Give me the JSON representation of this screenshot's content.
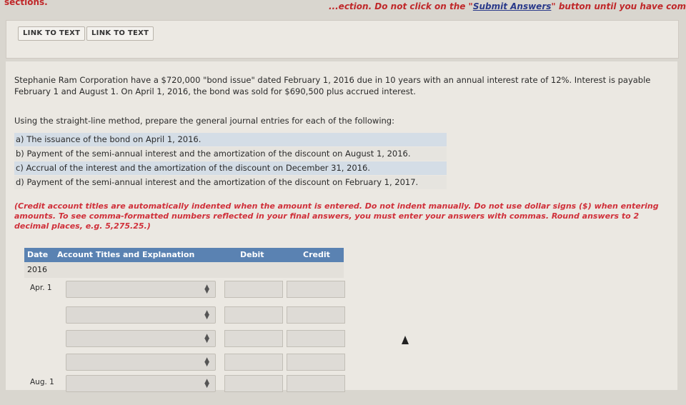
{
  "top": {
    "left_fragment": "sections.",
    "right_prefix": "...ection. Do not click on the \"",
    "right_link": "Submit Answers",
    "right_suffix": "\" button until you have completed all of the"
  },
  "links": [
    "LINK TO TEXT",
    "LINK TO TEXT"
  ],
  "problem_text": "Stephanie Ram Corporation have a $720,000 \"bond issue\" dated February 1, 2016 due in 10 years with an annual interest rate of 12%. Interest is payable February 1 and August 1. On April 1, 2016, the bond was sold for $690,500 plus accrued interest.",
  "instruction": "Using the straight-line method, prepare the general journal entries for each of the following:",
  "items": [
    "a)  The issuance of the bond on April 1, 2016.",
    "b)  Payment of the semi-annual interest and the amortization of the discount on August 1, 2016.",
    "c)  Accrual of the interest and the amortization of the discount on December 31, 2016.",
    "d)  Payment of the semi-annual interest and the amortization of the discount on February 1, 2017."
  ],
  "note": "(Credit account titles are automatically indented when the amount is entered. Do not indent manually. Do not use dollar signs ($) when entering amounts. To see comma-formatted numbers reflected in your final answers, you must enter your answers with commas. Round answers to 2 decimal places, e.g. 5,275.25.)",
  "table": {
    "headers": {
      "date": "Date",
      "account": "Account Titles and Explanation",
      "debit": "Debit",
      "credit": "Credit"
    },
    "year": "2016",
    "rows": [
      {
        "date": "Apr. 1"
      },
      {
        "date": ""
      },
      {
        "date": ""
      },
      {
        "date": ""
      },
      {
        "date": "Aug. 1"
      }
    ]
  }
}
